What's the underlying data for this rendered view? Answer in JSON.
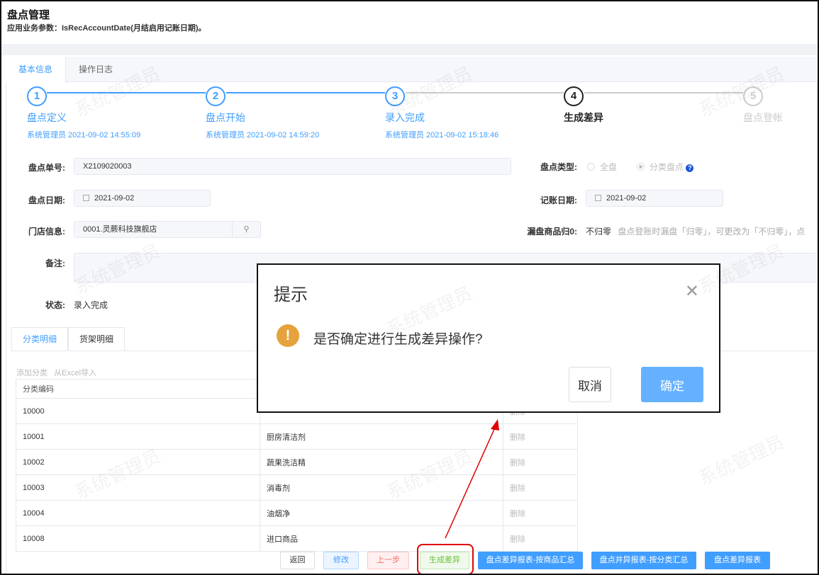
{
  "header": {
    "title": "盘点管理",
    "subtitle": "应用业务参数：IsRecAccountDate(月结启用记账日期)。"
  },
  "tabs": [
    {
      "label": "基本信息"
    },
    {
      "label": "操作日志"
    }
  ],
  "steps": [
    {
      "num": "1",
      "name": "盘点定义",
      "info": "系统管理员 2021-09-02 14:55:09",
      "state": "done"
    },
    {
      "num": "2",
      "name": "盘点开始",
      "info": "系统管理员 2021-09-02 14:59:20",
      "state": "done"
    },
    {
      "num": "3",
      "name": "录入完成",
      "info": "系统管理员 2021-09-02 15:18:46",
      "state": "done"
    },
    {
      "num": "4",
      "name": "生成差异",
      "info": "",
      "state": "current"
    },
    {
      "num": "5",
      "name": "盘点登帐",
      "info": "",
      "state": "pending"
    }
  ],
  "form": {
    "order_no_label": "盘点单号:",
    "order_no": "X2109020003",
    "type_label": "盘点类型:",
    "type_options": [
      "全盘",
      "分类盘点"
    ],
    "type_selected": "分类盘点",
    "date_label": "盘点日期:",
    "date": "2021-09-02",
    "acc_date_label": "记账日期:",
    "acc_date": "2021-09-02",
    "store_label": "门店信息:",
    "store": "0001.灵蕨科技旗舰店",
    "zero_label": "漏盘商品归0:",
    "zero_value": "不归零",
    "zero_hint": "盘点登账时漏盘「归零」，可更改为「不归零」，点",
    "remark_label": "备注:",
    "status_label": "状态:",
    "status": "录入完成"
  },
  "subtabs": [
    {
      "label": "分类明细"
    },
    {
      "label": "货架明细"
    }
  ],
  "table_actions": [
    "添加分类",
    "从Excel导入"
  ],
  "table": {
    "headers": [
      "分类编码",
      "",
      ""
    ],
    "rows": [
      [
        "10000",
        "",
        "删除"
      ],
      [
        "10001",
        "厨房清洁剂",
        "删除"
      ],
      [
        "10002",
        "蔬果洗洁精",
        "删除"
      ],
      [
        "10003",
        "消毒剂",
        "删除"
      ],
      [
        "10004",
        "油烟净",
        "删除"
      ],
      [
        "10008",
        "进口商品",
        "删除"
      ]
    ]
  },
  "buttons": {
    "back": "返回",
    "edit": "修改",
    "prev": "上一步",
    "gen": "生成差异",
    "rep1": "盘点差异报表-按商品汇总",
    "rep2": "盘点并异报表-按分类汇总",
    "rep3": "盘点差异报表"
  },
  "dialog": {
    "title": "提示",
    "message": "是否确定进行生成差异操作?",
    "cancel": "取消",
    "ok": "确定"
  },
  "watermark": "系统管理员",
  "colors": {
    "primary": "#409eff",
    "warning": "#e6a23c",
    "annotation": "#e00000"
  }
}
